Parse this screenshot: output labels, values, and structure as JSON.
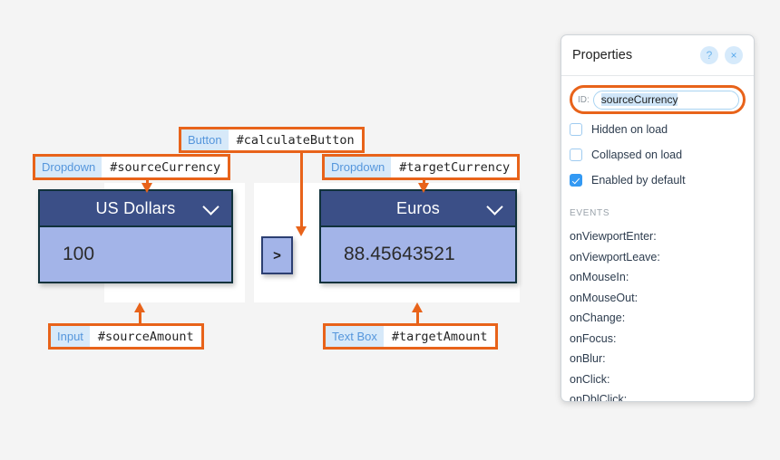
{
  "canvas": {
    "widgets": [
      {
        "name": "source",
        "dropdown_label": "US Dollars",
        "amount_value": "100",
        "chevron_icon": "chevron-down-icon"
      },
      {
        "name": "target",
        "dropdown_label": "Euros",
        "amount_value": "88.45643521",
        "chevron_icon": "chevron-down-icon"
      }
    ],
    "calculate_button_label": ">"
  },
  "annotations": [
    {
      "key": "calculate_button",
      "type": "Button",
      "id": "#calculateButton"
    },
    {
      "key": "source_currency",
      "type": "Dropdown",
      "id": "#sourceCurrency"
    },
    {
      "key": "target_currency",
      "type": "Dropdown",
      "id": "#targetCurrency"
    },
    {
      "key": "source_amount",
      "type": "Input",
      "id": "#sourceAmount"
    },
    {
      "key": "target_amount",
      "type": "Text Box",
      "id": "#targetAmount"
    }
  ],
  "properties_panel": {
    "title": "Properties",
    "help_icon": "?",
    "close_icon": "×",
    "id_label": "ID:",
    "id_value": "sourceCurrency",
    "checkboxes": [
      {
        "label": "Hidden on load",
        "checked": false
      },
      {
        "label": "Collapsed on load",
        "checked": false
      },
      {
        "label": "Enabled by default",
        "checked": true
      }
    ],
    "events_heading": "EVENTS",
    "events": [
      "onViewportEnter:",
      "onViewportLeave:",
      "onMouseIn:",
      "onMouseOut:",
      "onChange:",
      "onFocus:",
      "onBlur:",
      "onClick:",
      "onDblClick:"
    ]
  },
  "colors": {
    "annotation_orange": "#e8631a",
    "dropdown_navy": "#3b4f87",
    "field_periwinkle": "#a3b4e8",
    "tag_type_blue": "#5596dc",
    "tag_type_bg": "#d7e9f9",
    "checkbox_blue": "#3399f3",
    "canvas_white": "#ffffff",
    "page_gray": "#f4f4f4"
  }
}
